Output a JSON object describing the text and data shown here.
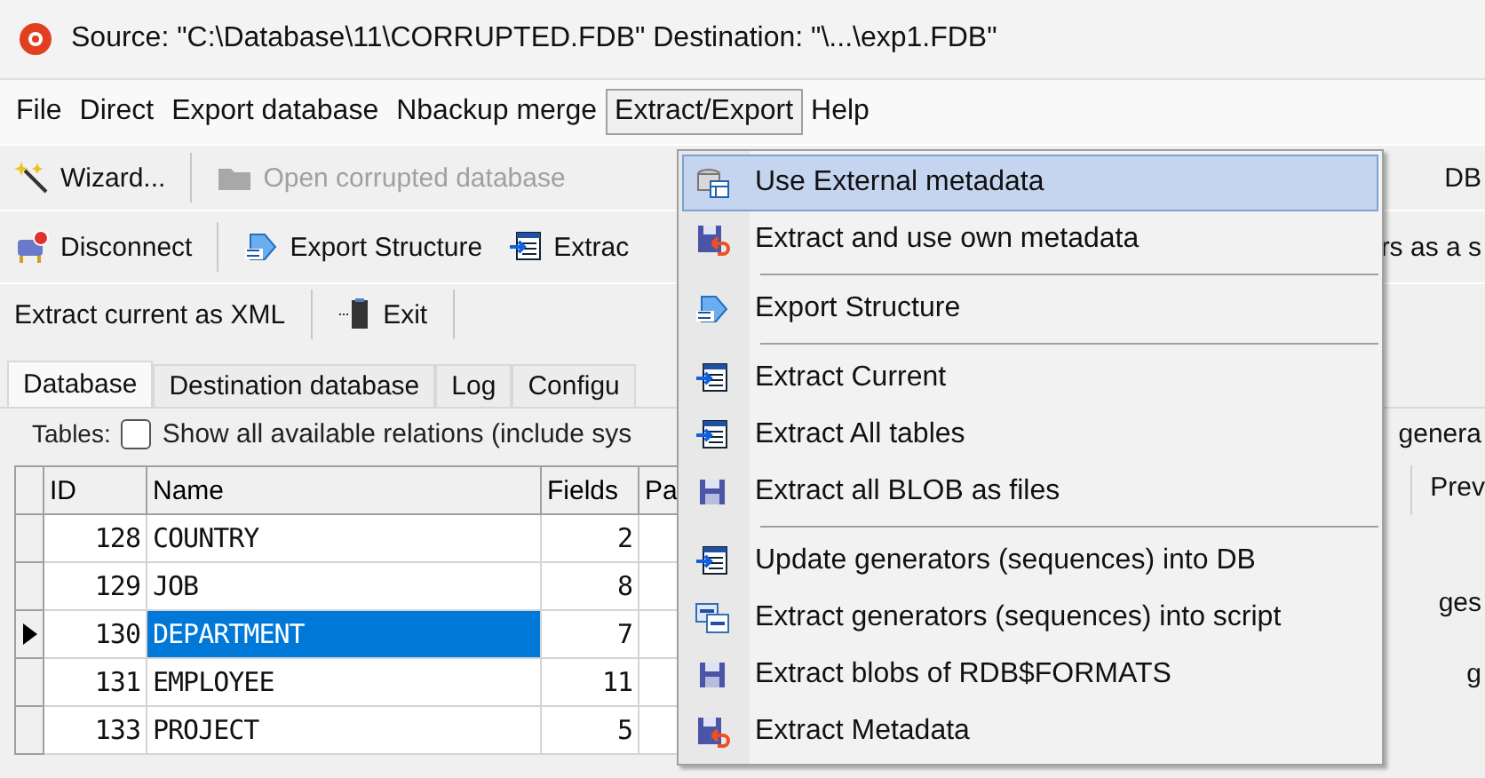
{
  "window": {
    "title": "Source: \"C:\\Database\\11\\CORRUPTED.FDB\" Destination: \"\\...\\exp1.FDB\""
  },
  "menu_bar": [
    {
      "label": "File",
      "selected": false
    },
    {
      "label": "Direct",
      "selected": false
    },
    {
      "label": "Export database",
      "selected": false
    },
    {
      "label": "Nbackup merge",
      "selected": false
    },
    {
      "label": "Extract/Export",
      "selected": true
    },
    {
      "label": "Help",
      "selected": false
    }
  ],
  "toolbar": [
    {
      "items": [
        {
          "label": "Wizard...",
          "disabled": false
        },
        {
          "label": "Open corrupted database",
          "disabled": true
        }
      ],
      "trailing": "DB"
    },
    {
      "items": [
        {
          "label": "Disconnect",
          "disabled": false
        },
        {
          "label": "Export Structure",
          "disabled": false
        },
        {
          "label": "Extrac",
          "disabled": false
        }
      ],
      "trailing": "rs as a s"
    },
    {
      "items": [
        {
          "label": "Extract current as XML",
          "disabled": false
        },
        {
          "label": "Exit",
          "disabled": false
        }
      ]
    }
  ],
  "tabs": [
    {
      "label": "Database",
      "selected": true
    },
    {
      "label": "Destination database",
      "selected": false
    },
    {
      "label": "Log",
      "selected": false
    },
    {
      "label": "Configu",
      "selected": false
    }
  ],
  "tables_option": {
    "label": "Tables:",
    "checkbox_label": "Show all available relations (include sys",
    "checked": false,
    "trailing": "genera"
  },
  "table": {
    "columns": [
      "ID",
      "Name",
      "Fields",
      "Pa"
    ],
    "trailing": "Prev",
    "rows": [
      {
        "id": "128",
        "name": "COUNTRY",
        "fields": "2",
        "selected": false
      },
      {
        "id": "129",
        "name": "JOB",
        "fields": "8",
        "selected": false,
        "trailing": "ges"
      },
      {
        "id": "130",
        "name": "DEPARTMENT",
        "fields": "7",
        "selected": true
      },
      {
        "id": "131",
        "name": "EMPLOYEE",
        "fields": "11",
        "selected": false,
        "trailing": "g"
      },
      {
        "id": "133",
        "name": "PROJECT",
        "fields": "5",
        "selected": false
      }
    ]
  },
  "dropdown_menu": [
    {
      "kind": "item",
      "label": "Use External metadata",
      "selected": true
    },
    {
      "kind": "item",
      "label": "Extract and use own metadata",
      "selected": false
    },
    {
      "kind": "separator"
    },
    {
      "kind": "item",
      "label": "Export Structure",
      "selected": false
    },
    {
      "kind": "separator"
    },
    {
      "kind": "item",
      "label": "Extract Current",
      "selected": false
    },
    {
      "kind": "item",
      "label": "Extract All tables",
      "selected": false
    },
    {
      "kind": "item",
      "label": "Extract all BLOB as files",
      "selected": false
    },
    {
      "kind": "separator"
    },
    {
      "kind": "item",
      "label": "Update generators (sequences) into DB",
      "selected": false
    },
    {
      "kind": "item",
      "label": "Extract generators (sequences) into script",
      "selected": false
    },
    {
      "kind": "item",
      "label": "Extract blobs of RDB$FORMATS",
      "selected": false
    },
    {
      "kind": "item",
      "label": "Extract Metadata",
      "selected": false
    }
  ]
}
